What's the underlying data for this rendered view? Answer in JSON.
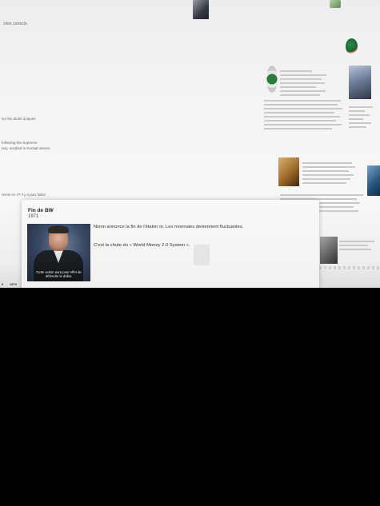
{
  "popup": {
    "title": "Fin de BW",
    "year": "1971",
    "paragraph1": "Nixon annonce la fin de l'étalon or. Les monnaies deviennent fluctuantes.",
    "paragraph2": "C'est la chute du « World Money 2.0 System ».",
    "video_caption": "Cette action aura pour effet de défendre le dollar."
  },
  "background_page": {
    "left_snippets": [
      "ches corrects.",
      "sur les droits uniques",
      "following the Supreme\ntary, recalled in Kerstal interes",
      "remis en 47 il y a jaux faliez"
    ],
    "timeline_years": [
      "0",
      "1973"
    ]
  },
  "icons": {
    "video": "video-thumbnail",
    "logo": "round-emblem-icon"
  }
}
